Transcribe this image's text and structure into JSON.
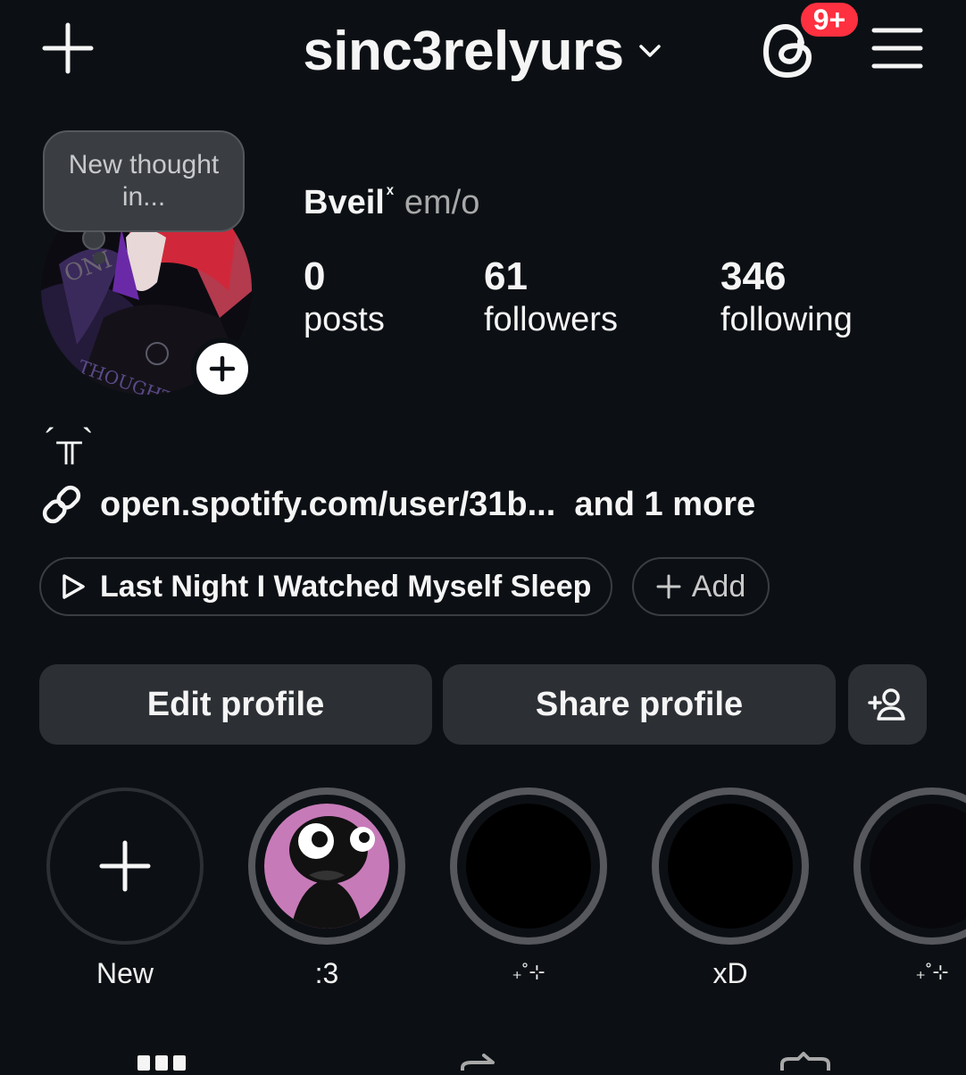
{
  "header": {
    "username": "sinc3relyurs",
    "notification_badge": "9+"
  },
  "note": {
    "text": "New thought in..."
  },
  "profile": {
    "display_name": "Bveil",
    "name_mark": "ˣ",
    "pronouns": "em/o",
    "bio": "´╥`",
    "link_text": "open.spotify.com/user/31b...  and 1 more"
  },
  "stats": [
    {
      "count": "0",
      "label": "posts"
    },
    {
      "count": "61",
      "label": "followers"
    },
    {
      "count": "346",
      "label": "following"
    }
  ],
  "music": {
    "song": "Last Night I Watched Myself Sleep",
    "add_label": "Add"
  },
  "buttons": {
    "edit": "Edit profile",
    "share": "Share profile"
  },
  "highlights": [
    {
      "label": "New"
    },
    {
      "label": ":3"
    },
    {
      "label": "₊˚⊹"
    },
    {
      "label": "xD"
    },
    {
      "label": "₊˚⊹"
    }
  ],
  "icons": {
    "create": "plus-icon",
    "chevron": "chevron-down-icon",
    "threads": "threads-icon",
    "menu": "hamburger-menu-icon",
    "link": "link-icon",
    "play": "play-icon",
    "add_user": "add-user-icon"
  },
  "colors": {
    "background": "#0c1014",
    "button": "#2c3035",
    "badge": "#ff3040",
    "secondary_text": "#a8a8a8"
  }
}
